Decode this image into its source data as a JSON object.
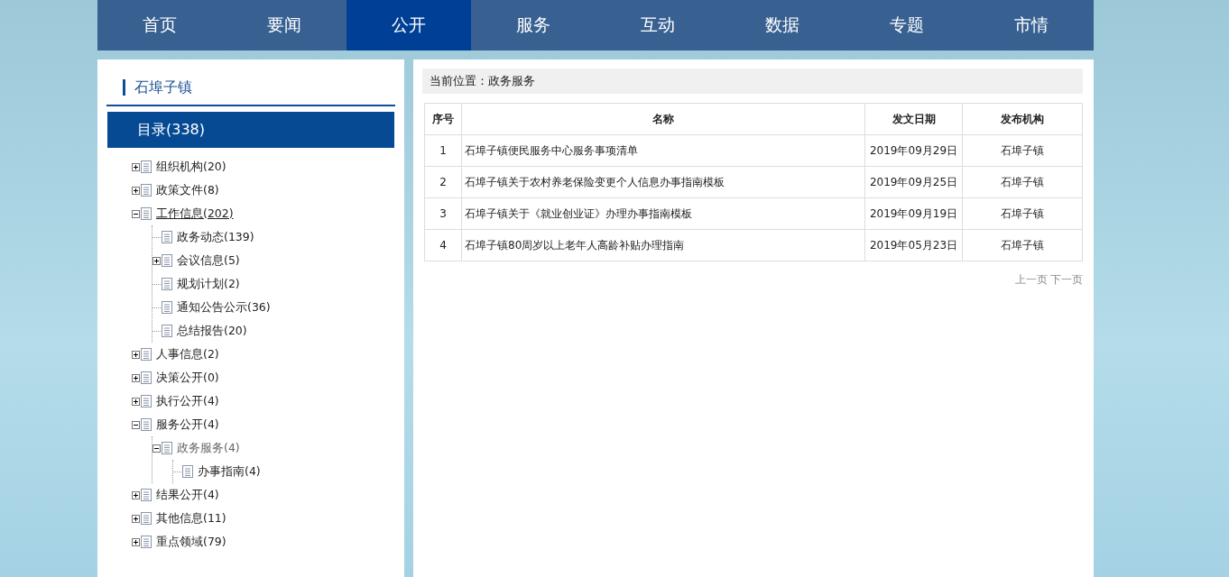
{
  "nav": [
    {
      "label": "首页",
      "selected": false
    },
    {
      "label": "要闻",
      "selected": false
    },
    {
      "label": "公开",
      "selected": true
    },
    {
      "label": "服务",
      "selected": false
    },
    {
      "label": "互动",
      "selected": false
    },
    {
      "label": "数据",
      "selected": false
    },
    {
      "label": "专题",
      "selected": false
    },
    {
      "label": "市情",
      "selected": false
    }
  ],
  "sidebar": {
    "title": "石埠子镇",
    "catalog": "目录(338)",
    "tree": [
      {
        "kind": "branch",
        "label": "组织机构(20)",
        "expanded": false,
        "selected": false,
        "hovered": false
      },
      {
        "kind": "branch",
        "label": "政策文件(8)",
        "expanded": false,
        "selected": false,
        "hovered": false
      },
      {
        "kind": "branch",
        "label": "工作信息(202)",
        "expanded": true,
        "selected": false,
        "hovered": true,
        "children": [
          {
            "kind": "leaf",
            "label": "政务动态(139)",
            "selected": false,
            "hovered": false
          },
          {
            "kind": "branch",
            "label": "会议信息(5)",
            "expanded": false,
            "selected": false,
            "hovered": false
          },
          {
            "kind": "leaf",
            "label": "规划计划(2)",
            "selected": false,
            "hovered": false
          },
          {
            "kind": "leaf",
            "label": "通知公告公示(36)",
            "selected": false,
            "hovered": false
          },
          {
            "kind": "leaf",
            "label": "总结报告(20)",
            "selected": false,
            "hovered": false
          }
        ]
      },
      {
        "kind": "branch",
        "label": "人事信息(2)",
        "expanded": false,
        "selected": false,
        "hovered": false
      },
      {
        "kind": "branch",
        "label": "决策公开(0)",
        "expanded": false,
        "selected": false,
        "hovered": false
      },
      {
        "kind": "branch",
        "label": "执行公开(4)",
        "expanded": false,
        "selected": false,
        "hovered": false
      },
      {
        "kind": "branch",
        "label": "服务公开(4)",
        "expanded": true,
        "selected": false,
        "hovered": false,
        "children": [
          {
            "kind": "branch",
            "label": "政务服务(4)",
            "expanded": true,
            "selected": true,
            "hovered": false,
            "children": [
              {
                "kind": "leaf",
                "label": "办事指南(4)",
                "selected": false,
                "hovered": false
              }
            ]
          }
        ]
      },
      {
        "kind": "branch",
        "label": "结果公开(4)",
        "expanded": false,
        "selected": false,
        "hovered": false
      },
      {
        "kind": "branch",
        "label": "其他信息(11)",
        "expanded": false,
        "selected": false,
        "hovered": false
      },
      {
        "kind": "branch",
        "label": "重点领域(79)",
        "expanded": false,
        "selected": false,
        "hovered": false
      }
    ]
  },
  "breadcrumb": "当前位置：政务服务",
  "table": {
    "columns": [
      "序号",
      "名称",
      "发文日期",
      "发布机构"
    ],
    "rows": [
      [
        "1",
        "石埠子镇便民服务中心服务事项清单",
        "2019年09月29日",
        "石埠子镇"
      ],
      [
        "2",
        "石埠子镇关于农村养老保险变更个人信息办事指南模板",
        "2019年09月25日",
        "石埠子镇"
      ],
      [
        "3",
        "石埠子镇关于《就业创业证》办理办事指南模板",
        "2019年09月19日",
        "石埠子镇"
      ],
      [
        "4",
        "石埠子镇80周岁以上老年人高龄补贴办理指南",
        "2019年05月23日",
        "石埠子镇"
      ]
    ]
  },
  "pager": {
    "prev": "上一页",
    "next": "下一页"
  }
}
